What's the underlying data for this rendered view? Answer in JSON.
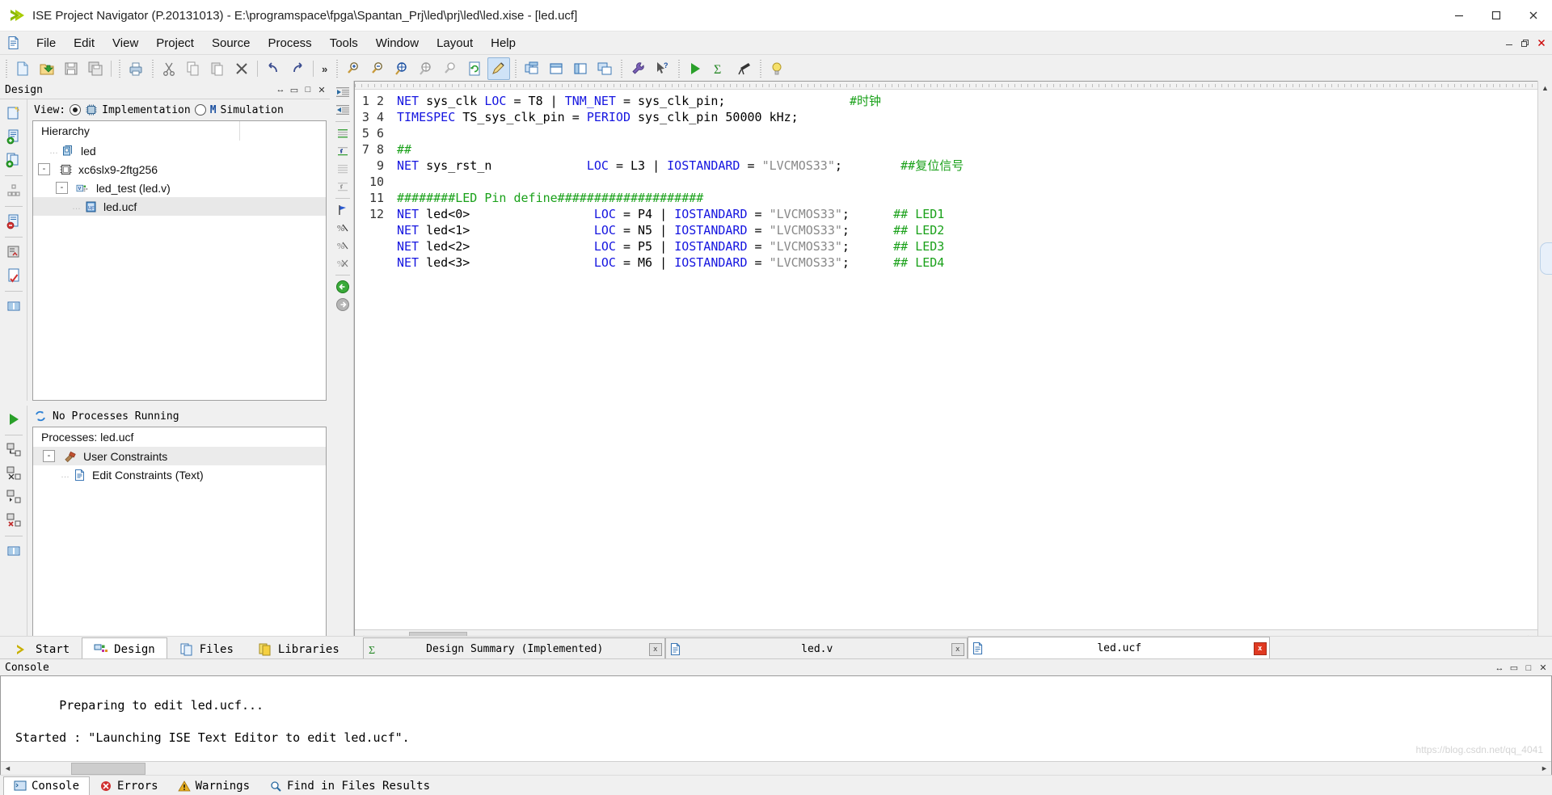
{
  "window": {
    "title": "ISE Project Navigator (P.20131013) - E:\\programspace\\fpga\\Spantan_Prj\\led\\prj\\led\\led.xise - [led.ucf]",
    "app_icon": "ise-arrow-icon",
    "minimize": "–",
    "maximize": "❑",
    "close": "✕"
  },
  "menu": {
    "doc_icon": "document-icon",
    "items": [
      {
        "label": "File"
      },
      {
        "label": "Edit"
      },
      {
        "label": "View"
      },
      {
        "label": "Project"
      },
      {
        "label": "Source"
      },
      {
        "label": "Process"
      },
      {
        "label": "Tools"
      },
      {
        "label": "Window"
      },
      {
        "label": "Layout"
      },
      {
        "label": "Help"
      }
    ],
    "win_min": "–",
    "win_restore": "❐",
    "win_close": "✕"
  },
  "toolbar": {
    "groups": [
      [
        "new-file-icon",
        "open-folder-icon",
        "save-icon",
        "save-all-icon"
      ],
      [
        "print-icon"
      ],
      [
        "cut-icon",
        "copy-icon",
        "paste-icon",
        "delete-icon"
      ],
      [
        "undo-icon",
        "redo-icon"
      ],
      [
        "overflow-chevron"
      ]
    ],
    "group2": [
      [
        "zoom-in-icon",
        "zoom-out-icon",
        "zoom-fit-icon",
        "zoom-region-icon",
        "zoom-select-icon",
        "refresh-icon",
        "edit-highlight-icon"
      ],
      [
        "tile-windows-icon",
        "split-horizontal-icon",
        "split-vertical-icon",
        "cascade-icon"
      ],
      [
        "wrench-icon",
        "help-pointer-icon"
      ],
      [
        "run-icon",
        "sum-icon",
        "telescope-icon"
      ],
      [
        "lightbulb-icon"
      ]
    ],
    "overflow_label": "»"
  },
  "design_panel": {
    "title": "Design",
    "btn_float": "↔",
    "btn_restore": "▭",
    "btn_max": "□",
    "btn_close": "✕",
    "view_label": "View:",
    "view_options": [
      {
        "label": "Implementation",
        "icon": "chip-icon",
        "selected": true
      },
      {
        "label": "Simulation",
        "icon": "m-icon",
        "selected": false
      }
    ],
    "hierarchy_header": "Hierarchy",
    "tree": [
      {
        "label": "led",
        "icon": "project-icon",
        "depth": 1,
        "expander": "",
        "selected": false
      },
      {
        "label": "xc6slx9-2ftg256",
        "icon": "device-icon",
        "depth": 1,
        "expander": "-",
        "selected": false
      },
      {
        "label": "led_test (led.v)",
        "icon": "verilog-icon",
        "depth": 2,
        "expander": "-",
        "selected": false
      },
      {
        "label": "led.ucf",
        "icon": "ucf-icon",
        "depth": 3,
        "expander": "",
        "selected": true
      }
    ],
    "vtools": [
      "new-source-icon",
      "add-source-icon",
      "add-copy-source-icon",
      "view-design-summary-icon",
      "remove-source-icon",
      "design-utilities-icon",
      "check-syntax-icon",
      "design-goals-icon"
    ]
  },
  "processes_panel": {
    "run_icon": "run-green-arrow-icon",
    "status": "No Processes Running",
    "status_icon": "refresh-blue-icon",
    "title": "Processes: led.ucf",
    "tree": [
      {
        "label": "User Constraints",
        "icon": "constraints-hammer-icon",
        "expander": "-",
        "depth": 1,
        "highlighted": true
      },
      {
        "label": "Edit Constraints (Text)",
        "icon": "text-doc-icon",
        "expander": "",
        "depth": 2,
        "highlighted": false
      }
    ],
    "vtools": [
      "implement-top-icon",
      "rerun-all-icon",
      "rerun-icon",
      "stop-process-icon",
      "design-summary-icon"
    ]
  },
  "editor": {
    "gutter_tools": [
      "indent-left-icon",
      "indent-right-icon",
      "bookmark-toggle-icon",
      "bookmark-prev-icon",
      "bookmark-lines-icon",
      "bookmark-undo-icon",
      "flag-icon",
      "breakpoint-toggle-icon",
      "breakpoint-clear-icon",
      "breakpoint-disable-icon",
      "back-green-icon",
      "forward-gray-icon"
    ],
    "line_numbers": [
      1,
      2,
      3,
      4,
      5,
      6,
      7,
      8,
      9,
      10,
      11,
      12
    ],
    "code_lines": [
      [
        {
          "t": "NET ",
          "c": "kw"
        },
        {
          "t": "sys_clk ",
          "c": "plain"
        },
        {
          "t": "LOC ",
          "c": "kw"
        },
        {
          "t": "= T8 | ",
          "c": "plain"
        },
        {
          "t": "TNM_NET ",
          "c": "kw"
        },
        {
          "t": "= sys_clk_pin;",
          "c": "plain"
        },
        {
          "t": "                 ",
          "c": "plain"
        },
        {
          "t": "#时钟",
          "c": "cm"
        }
      ],
      [
        {
          "t": "TIMESPEC ",
          "c": "kw"
        },
        {
          "t": "TS_sys_clk_pin = ",
          "c": "plain"
        },
        {
          "t": "PERIOD ",
          "c": "kw"
        },
        {
          "t": "sys_clk_pin 50000 kHz;",
          "c": "plain"
        }
      ],
      [],
      [
        {
          "t": "##",
          "c": "cm"
        }
      ],
      [
        {
          "t": "NET ",
          "c": "kw"
        },
        {
          "t": "sys_rst_n             ",
          "c": "plain"
        },
        {
          "t": "LOC ",
          "c": "kw"
        },
        {
          "t": "= L3 | ",
          "c": "plain"
        },
        {
          "t": "IOSTANDARD ",
          "c": "kw"
        },
        {
          "t": "= ",
          "c": "plain"
        },
        {
          "t": "\"LVCMOS33\"",
          "c": "str"
        },
        {
          "t": ";",
          "c": "plain"
        },
        {
          "t": "        ",
          "c": "plain"
        },
        {
          "t": "##复位信号",
          "c": "cm"
        }
      ],
      [],
      [
        {
          "t": "########LED Pin define####################",
          "c": "cm"
        }
      ],
      [
        {
          "t": "NET ",
          "c": "kw"
        },
        {
          "t": "led<0>                 ",
          "c": "plain"
        },
        {
          "t": "LOC ",
          "c": "kw"
        },
        {
          "t": "= P4 | ",
          "c": "plain"
        },
        {
          "t": "IOSTANDARD ",
          "c": "kw"
        },
        {
          "t": "= ",
          "c": "plain"
        },
        {
          "t": "\"LVCMOS33\"",
          "c": "str"
        },
        {
          "t": ";",
          "c": "plain"
        },
        {
          "t": "      ",
          "c": "plain"
        },
        {
          "t": "## LED1",
          "c": "cm"
        }
      ],
      [
        {
          "t": "NET ",
          "c": "kw"
        },
        {
          "t": "led<1>                 ",
          "c": "plain"
        },
        {
          "t": "LOC ",
          "c": "kw"
        },
        {
          "t": "= N5 | ",
          "c": "plain"
        },
        {
          "t": "IOSTANDARD ",
          "c": "kw"
        },
        {
          "t": "= ",
          "c": "plain"
        },
        {
          "t": "\"LVCMOS33\"",
          "c": "str"
        },
        {
          "t": ";",
          "c": "plain"
        },
        {
          "t": "      ",
          "c": "plain"
        },
        {
          "t": "## LED2",
          "c": "cm"
        }
      ],
      [
        {
          "t": "NET ",
          "c": "kw"
        },
        {
          "t": "led<2>                 ",
          "c": "plain"
        },
        {
          "t": "LOC ",
          "c": "kw"
        },
        {
          "t": "= P5 | ",
          "c": "plain"
        },
        {
          "t": "IOSTANDARD ",
          "c": "kw"
        },
        {
          "t": "= ",
          "c": "plain"
        },
        {
          "t": "\"LVCMOS33\"",
          "c": "str"
        },
        {
          "t": ";",
          "c": "plain"
        },
        {
          "t": "      ",
          "c": "plain"
        },
        {
          "t": "## LED3",
          "c": "cm"
        }
      ],
      [
        {
          "t": "NET ",
          "c": "kw"
        },
        {
          "t": "led<3>                 ",
          "c": "plain"
        },
        {
          "t": "LOC ",
          "c": "kw"
        },
        {
          "t": "= M6 | ",
          "c": "plain"
        },
        {
          "t": "IOSTANDARD ",
          "c": "kw"
        },
        {
          "t": "= ",
          "c": "plain"
        },
        {
          "t": "\"LVCMOS33\"",
          "c": "str"
        },
        {
          "t": ";",
          "c": "plain"
        },
        {
          "t": "      ",
          "c": "plain"
        },
        {
          "t": "## LED4",
          "c": "cm"
        }
      ],
      []
    ],
    "scroll_left_arrow": "◄",
    "scroll_right_arrow": "►",
    "scroll_up_arrow": "▲",
    "scroll_down_arrow": "▼"
  },
  "panel_tabs": [
    {
      "label": "Start",
      "icon": "start-arrow-icon",
      "active": false
    },
    {
      "label": "Design",
      "icon": "design-icon",
      "active": true
    },
    {
      "label": "Files",
      "icon": "files-icon",
      "active": false
    },
    {
      "label": "Libraries",
      "icon": "libraries-icon",
      "active": false
    }
  ],
  "document_tabs": [
    {
      "label": "Design Summary (Implemented)",
      "icon": "sigma-icon",
      "close": "x",
      "active": false,
      "close_style": "gray"
    },
    {
      "label": "led.v",
      "icon": "doc-blue-icon",
      "close": "x",
      "active": false,
      "close_style": "gray"
    },
    {
      "label": "led.ucf",
      "icon": "doc-blue-icon",
      "close": "x",
      "active": true,
      "close_style": "red"
    }
  ],
  "console": {
    "title": "Console",
    "btn_float": "↔",
    "btn_restore": "▭",
    "btn_max": "□",
    "btn_close": "✕",
    "lines": [
      "Preparing to edit led.ucf...",
      "",
      "Started : \"Launching ISE Text Editor to edit led.ucf\"."
    ],
    "watermark": "https://blog.csdn.net/qq_4041"
  },
  "status_tabs": [
    {
      "label": "Console",
      "icon": "console-icon",
      "active": true
    },
    {
      "label": "Errors",
      "icon": "error-icon",
      "active": false
    },
    {
      "label": "Warnings",
      "icon": "warning-icon",
      "active": false
    },
    {
      "label": "Find in Files Results",
      "icon": "find-icon",
      "active": false
    }
  ],
  "colors": {
    "keyword": "#1515e0",
    "comment": "#1aa11a",
    "string": "#888888",
    "accent": "#2a7fd4",
    "close_red": "#e03a22"
  }
}
